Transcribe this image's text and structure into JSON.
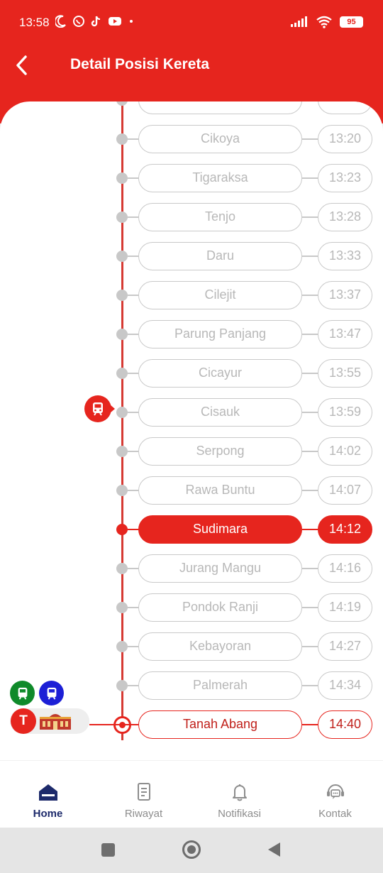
{
  "status_bar": {
    "time": "13:58",
    "battery": "95",
    "icons_left": [
      "moon-icon",
      "whatsapp-icon",
      "tiktok-icon",
      "youtube-icon",
      "dot-icon"
    ],
    "icons_right": [
      "signal-icon",
      "wifi-icon",
      "battery-icon"
    ]
  },
  "header": {
    "title": "Detail Posisi Kereta",
    "back_icon": "back-arrow-icon"
  },
  "stations": [
    {
      "name": "",
      "time": "",
      "state": "past"
    },
    {
      "name": "Cikoya",
      "time": "13:20",
      "state": "past"
    },
    {
      "name": "Tigaraksa",
      "time": "13:23",
      "state": "past"
    },
    {
      "name": "Tenjo",
      "time": "13:28",
      "state": "past"
    },
    {
      "name": "Daru",
      "time": "13:33",
      "state": "past"
    },
    {
      "name": "Cilejit",
      "time": "13:37",
      "state": "past"
    },
    {
      "name": "Parung Panjang",
      "time": "13:47",
      "state": "past"
    },
    {
      "name": "Cicayur",
      "time": "13:55",
      "state": "past"
    },
    {
      "name": "Cisauk",
      "time": "13:59",
      "state": "train-position"
    },
    {
      "name": "Serpong",
      "time": "14:02",
      "state": "upcoming"
    },
    {
      "name": "Rawa Buntu",
      "time": "14:07",
      "state": "upcoming"
    },
    {
      "name": "Sudimara",
      "time": "14:12",
      "state": "selected"
    },
    {
      "name": "Jurang Mangu",
      "time": "14:16",
      "state": "upcoming"
    },
    {
      "name": "Pondok Ranji",
      "time": "14:19",
      "state": "upcoming"
    },
    {
      "name": "Kebayoran",
      "time": "14:27",
      "state": "upcoming"
    },
    {
      "name": "Palmerah",
      "time": "14:34",
      "state": "upcoming"
    },
    {
      "name": "Tanah Abang",
      "time": "14:40",
      "state": "destination"
    }
  ],
  "transfer": {
    "badge_letter": "T",
    "line_colors": [
      "#0f8a2a",
      "#1c1fd6"
    ]
  },
  "bottom_nav": [
    {
      "label": "Home",
      "icon": "home-icon",
      "active": true
    },
    {
      "label": "Riwayat",
      "icon": "history-document-icon",
      "active": false
    },
    {
      "label": "Notifikasi",
      "icon": "bell-icon",
      "active": false
    },
    {
      "label": "Kontak",
      "icon": "contact-chat-icon",
      "active": false
    }
  ],
  "colors": {
    "accent": "#e6251e",
    "nav_active": "#1d2a6b",
    "inactive": "#c8c8c8"
  }
}
